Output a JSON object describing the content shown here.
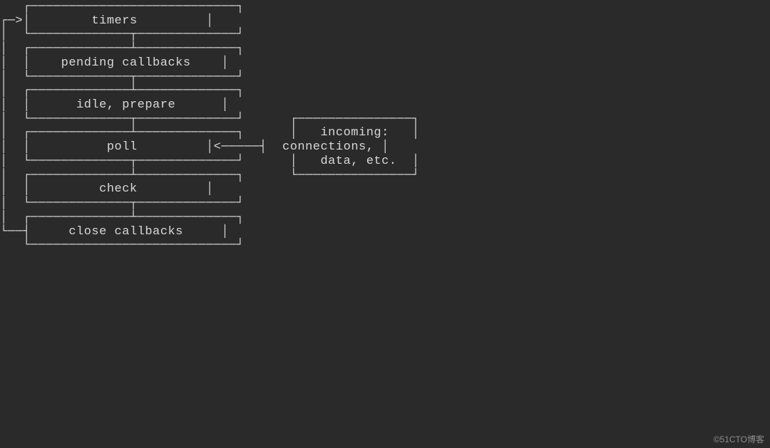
{
  "diagram": {
    "type": "event-loop-phases",
    "phases": [
      {
        "name": "timers",
        "label": "timers"
      },
      {
        "name": "pending-callbacks",
        "label": "pending callbacks"
      },
      {
        "name": "idle-prepare",
        "label": "idle, prepare"
      },
      {
        "name": "poll",
        "label": "poll"
      },
      {
        "name": "check",
        "label": "check"
      },
      {
        "name": "close-callbacks",
        "label": "close callbacks"
      }
    ],
    "loop_entry_arrow": "┌─>",
    "loop_back_arrow": "└──",
    "poll_input_arrow": "<─────",
    "poll_input_label": "connections,",
    "side_box": {
      "lines": [
        "incoming:",
        "data, etc."
      ]
    }
  },
  "watermark": "©51CTO博客"
}
